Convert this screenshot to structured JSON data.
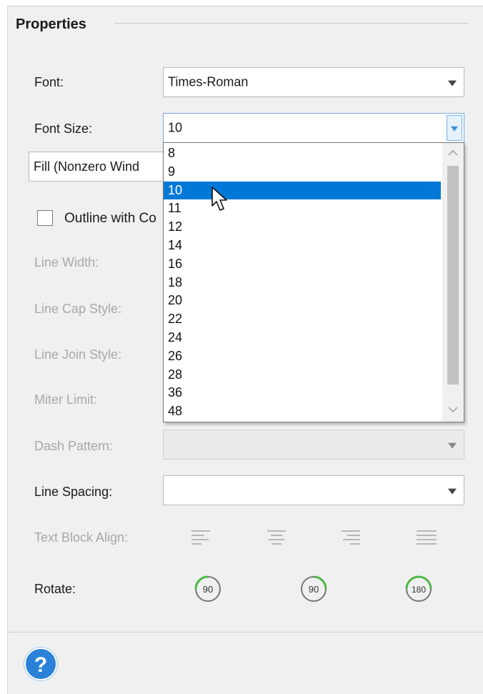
{
  "section": {
    "title": "Properties"
  },
  "font": {
    "label": "Font:",
    "value": "Times-Roman"
  },
  "font_size": {
    "label": "Font Size:",
    "value": "10",
    "options": [
      "8",
      "9",
      "10",
      "11",
      "12",
      "14",
      "16",
      "18",
      "20",
      "22",
      "24",
      "26",
      "28",
      "36",
      "48"
    ],
    "selected": "10"
  },
  "fill_mode": {
    "value": "Fill (Nonzero Wind"
  },
  "outline": {
    "label": "Outline with Co",
    "checked": false
  },
  "line_width": {
    "label": "Line Width:"
  },
  "line_cap": {
    "label": "Line Cap Style:"
  },
  "line_join": {
    "label": "Line Join Style:"
  },
  "miter_limit": {
    "label": "Miter Limit:"
  },
  "dash_pattern": {
    "label": "Dash Pattern:",
    "value": ""
  },
  "line_spacing": {
    "label": "Line Spacing:",
    "value": ""
  },
  "text_block_align": {
    "label": "Text Block Align:",
    "options": [
      "align-left-icon",
      "align-center-icon",
      "align-right-icon",
      "align-justify-icon"
    ]
  },
  "rotate": {
    "label": "Rotate:",
    "buttons": [
      {
        "icon": "rotate-ccw-90-icon",
        "text": "90"
      },
      {
        "icon": "rotate-cw-90-icon",
        "text": "90"
      },
      {
        "icon": "rotate-180-icon",
        "text": "180"
      }
    ]
  },
  "help": {
    "glyph": "?"
  },
  "colors": {
    "accent": "#0078d7",
    "rotate_green": "#4cb848",
    "help_blue": "#2a82d8",
    "disabled_text": "#a8a8a8"
  }
}
